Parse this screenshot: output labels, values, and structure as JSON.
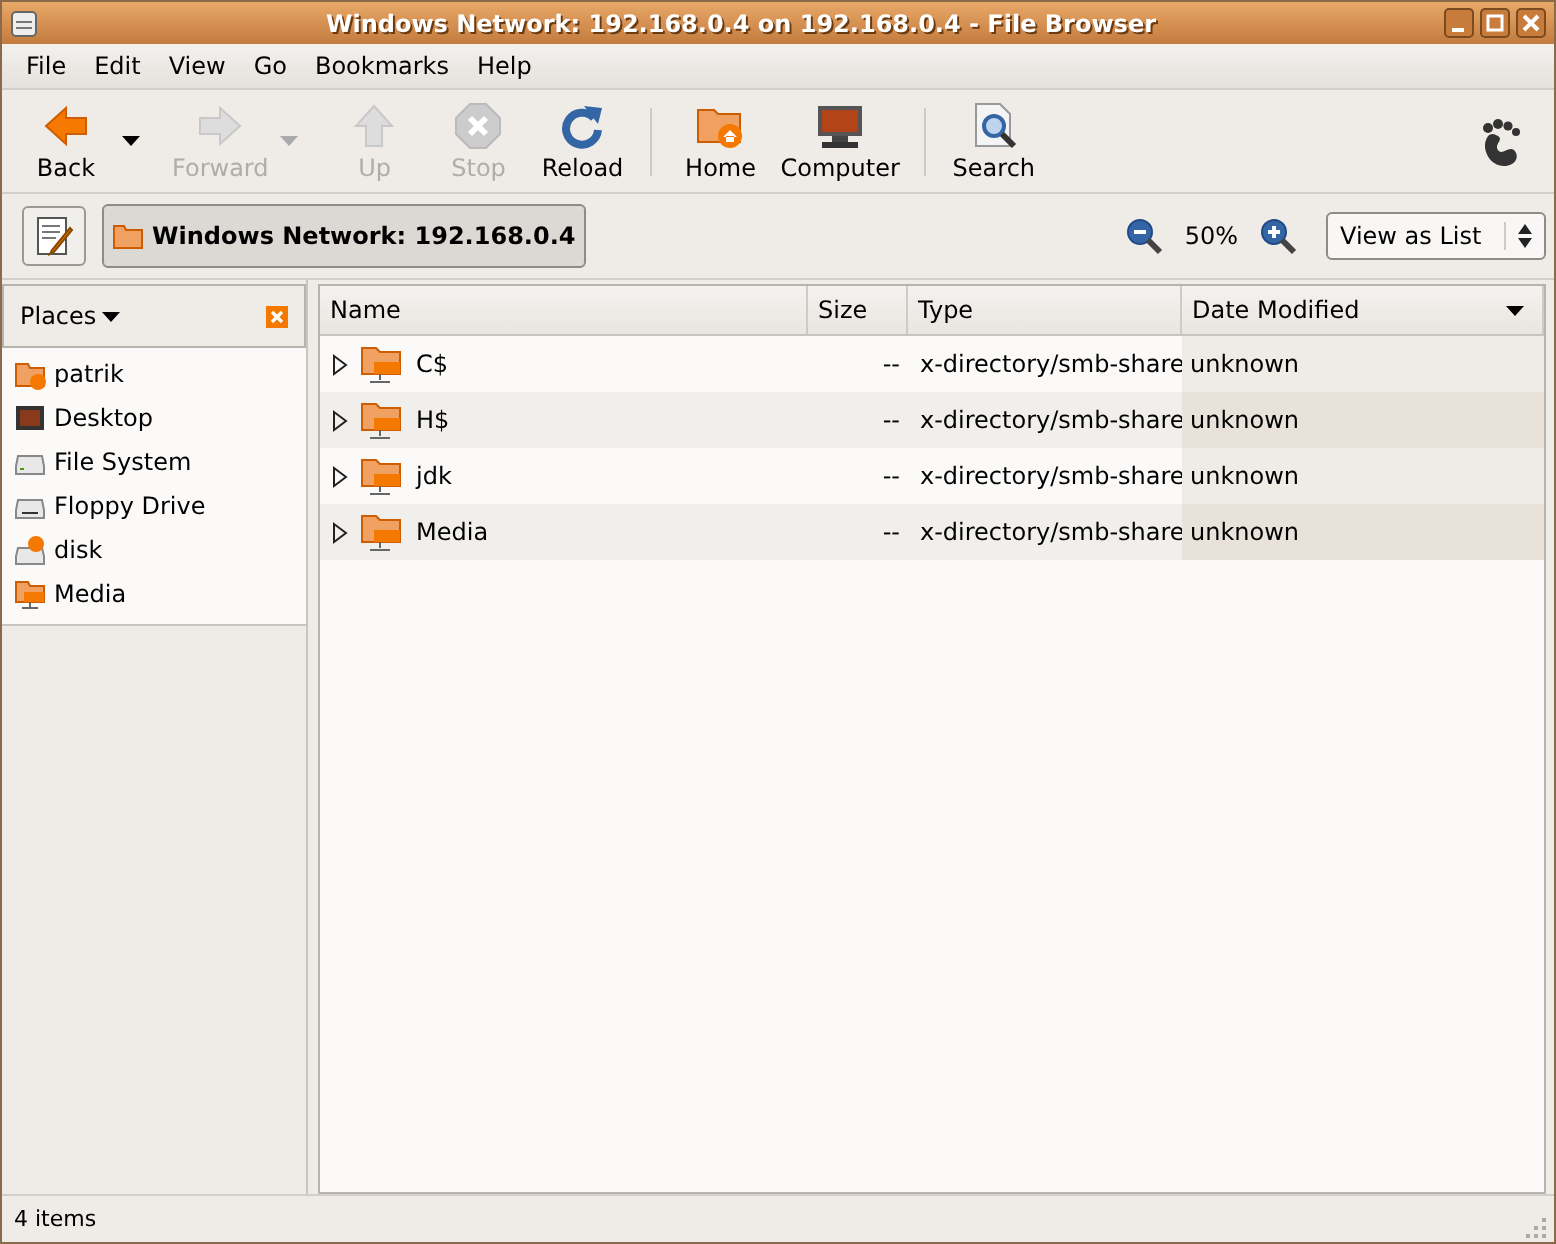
{
  "window": {
    "title": "Windows Network: 192.168.0.4 on 192.168.0.4 - File Browser"
  },
  "menu": [
    "File",
    "Edit",
    "View",
    "Go",
    "Bookmarks",
    "Help"
  ],
  "toolbar": [
    {
      "label": "Back",
      "kind": "back",
      "disabled": false
    },
    {
      "kind": "dropdown",
      "disabled": false
    },
    {
      "label": "Forward",
      "kind": "forward",
      "disabled": true
    },
    {
      "kind": "dropdown",
      "disabled": true
    },
    {
      "label": "Up",
      "kind": "up",
      "disabled": true
    },
    {
      "label": "Stop",
      "kind": "stop",
      "disabled": true
    },
    {
      "label": "Reload",
      "kind": "reload",
      "disabled": false
    },
    {
      "kind": "separator"
    },
    {
      "label": "Home",
      "kind": "home",
      "disabled": false
    },
    {
      "label": "Computer",
      "kind": "computer",
      "disabled": false
    },
    {
      "kind": "separator"
    },
    {
      "label": "Search",
      "kind": "search",
      "disabled": false
    }
  ],
  "location": {
    "path": "Windows Network: 192.168.0.4",
    "zoom": "50%",
    "view": "View as List"
  },
  "sidebar": {
    "title": "Places",
    "items": [
      {
        "label": "patrik",
        "kind": "home"
      },
      {
        "label": "Desktop",
        "kind": "desktop"
      },
      {
        "label": "File System",
        "kind": "drive"
      },
      {
        "label": "Floppy Drive",
        "kind": "floppy"
      },
      {
        "label": "disk",
        "kind": "usb"
      },
      {
        "label": "Media",
        "kind": "smb"
      }
    ]
  },
  "table": {
    "columns": [
      {
        "label": "Name",
        "sorted": false
      },
      {
        "label": "Size",
        "sorted": false
      },
      {
        "label": "Type",
        "sorted": false
      },
      {
        "label": "Date Modified",
        "sorted": true
      }
    ],
    "rows": [
      {
        "name": "C$",
        "size": "--",
        "type": "x-directory/smb-share",
        "date": "unknown"
      },
      {
        "name": "H$",
        "size": "--",
        "type": "x-directory/smb-share",
        "date": "unknown"
      },
      {
        "name": "jdk",
        "size": "--",
        "type": "x-directory/smb-share",
        "date": "unknown"
      },
      {
        "name": "Media",
        "size": "--",
        "type": "x-directory/smb-share",
        "date": "unknown"
      }
    ]
  },
  "status_bar": "4 items"
}
